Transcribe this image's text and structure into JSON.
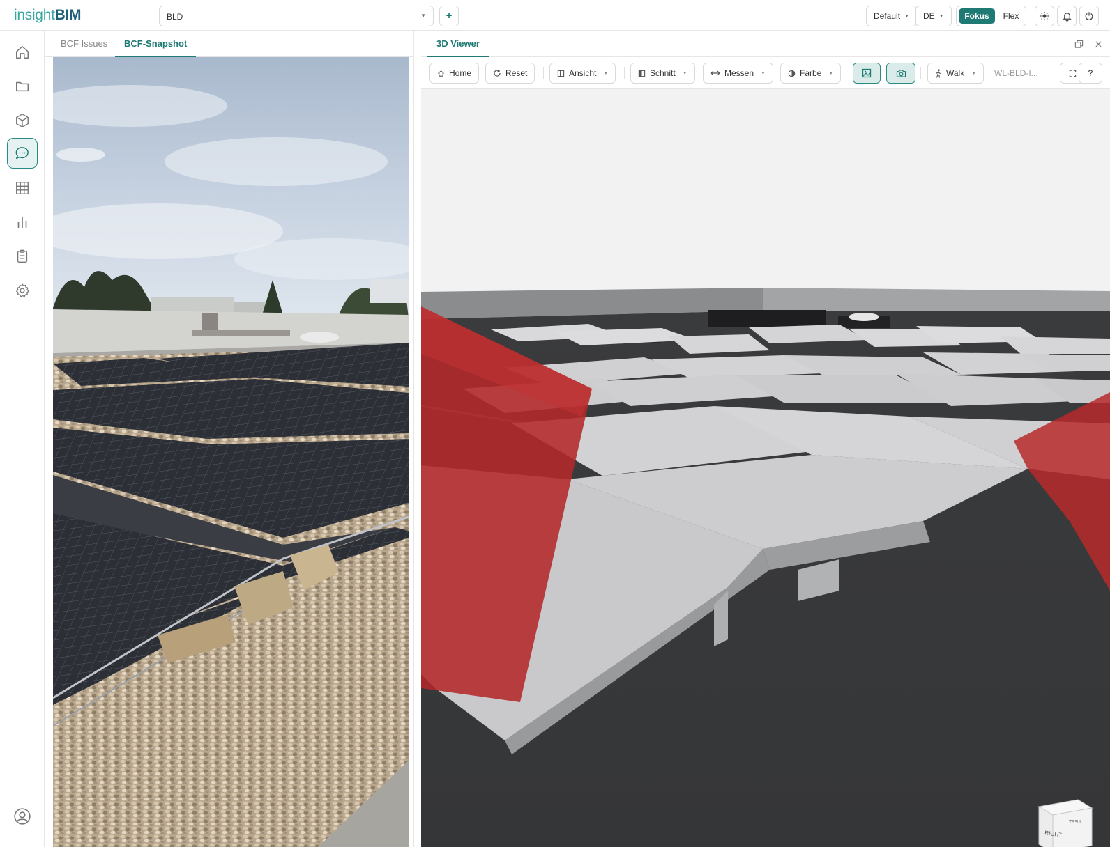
{
  "app": {
    "logo_part1": "insight",
    "logo_part2": "BIM"
  },
  "header": {
    "project_value": "BLD",
    "add_label": "+",
    "profile_value": "Default",
    "language_value": "DE",
    "mode_active": "Fokus",
    "mode_inactive": "Flex",
    "icons": [
      "sun-icon",
      "bell-icon",
      "power-icon"
    ]
  },
  "sidebar": {
    "items": [
      {
        "icon": "home-icon",
        "active": false
      },
      {
        "icon": "folder-icon",
        "active": false
      },
      {
        "icon": "cube-icon",
        "active": false
      },
      {
        "icon": "chat-icon",
        "active": true
      },
      {
        "icon": "grid-icon",
        "active": false
      },
      {
        "icon": "bar-chart-icon",
        "active": false
      },
      {
        "icon": "clipboard-icon",
        "active": false
      },
      {
        "icon": "gear-icon",
        "active": false
      }
    ],
    "bottom_icon": "user-icon"
  },
  "left_panel": {
    "tabs": [
      {
        "label": "BCF Issues",
        "active": false
      },
      {
        "label": "BCF-Snapshot",
        "active": true
      }
    ]
  },
  "viewer": {
    "tab_label": "3D Viewer",
    "toolbar": {
      "home": "Home",
      "reset": "Reset",
      "view": "Ansicht",
      "section": "Schnitt",
      "measure": "Messen",
      "color": "Farbe",
      "walk": "Walk",
      "model": "WL-BLD-I...",
      "help": "?"
    },
    "navcube": {
      "right": "RIGHT",
      "left": "LEFT",
      "mode": "3D"
    },
    "accent": "#1f7a74"
  }
}
